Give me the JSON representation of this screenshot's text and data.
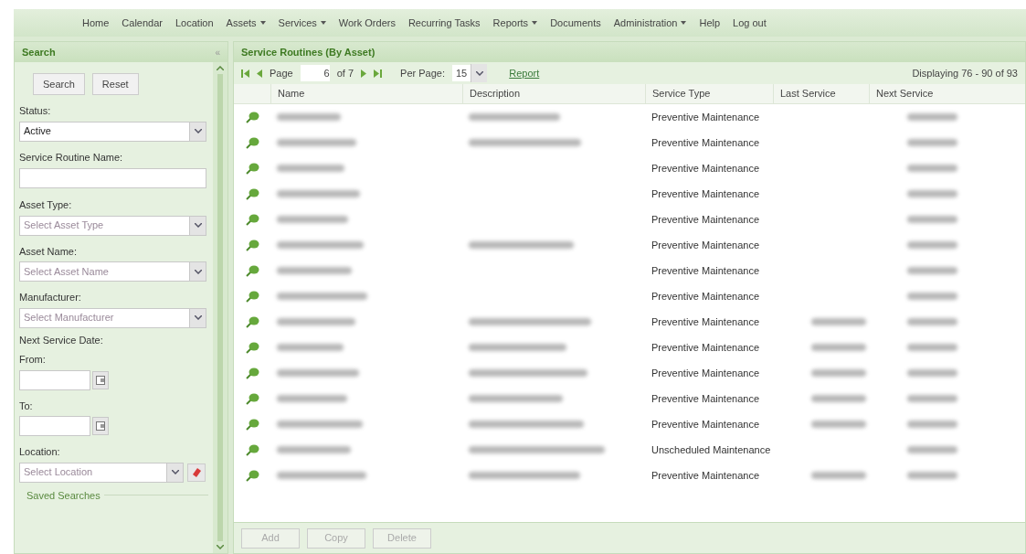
{
  "nav": [
    {
      "label": "Home",
      "dropdown": false
    },
    {
      "label": "Calendar",
      "dropdown": false
    },
    {
      "label": "Location",
      "dropdown": false
    },
    {
      "label": "Assets",
      "dropdown": true
    },
    {
      "label": "Services",
      "dropdown": true
    },
    {
      "label": "Work Orders",
      "dropdown": false
    },
    {
      "label": "Recurring Tasks",
      "dropdown": false
    },
    {
      "label": "Reports",
      "dropdown": true
    },
    {
      "label": "Documents",
      "dropdown": false
    },
    {
      "label": "Administration",
      "dropdown": true
    },
    {
      "label": "Help",
      "dropdown": false
    },
    {
      "label": "Log out",
      "dropdown": false
    }
  ],
  "search_panel": {
    "title": "Search",
    "collapse": "«",
    "buttons": [
      "Search",
      "Reset"
    ],
    "fields": [
      {
        "kind": "select",
        "label": "Status:",
        "value": "Active"
      },
      {
        "kind": "text",
        "label": "Service Routine Name:"
      },
      {
        "kind": "select",
        "label": "Asset Type:",
        "placeholder": "Select Asset Type"
      },
      {
        "kind": "select",
        "label": "Asset Name:",
        "placeholder": "Select Asset Name"
      },
      {
        "kind": "select",
        "label": "Manufacturer:",
        "placeholder": "Select Manufacturer"
      },
      {
        "kind": "heading",
        "label": "Next Service Date:"
      },
      {
        "kind": "date",
        "label": "From:"
      },
      {
        "kind": "date",
        "label": "To:"
      },
      {
        "kind": "select_clear",
        "label": "Location:",
        "placeholder": "Select Location"
      }
    ],
    "saved_searches": "Saved Searches"
  },
  "grid": {
    "title": "Service Routines (By Asset)",
    "page_label": "Page",
    "page": "6",
    "of": "of 7",
    "per_page_label": "Per Page:",
    "per_page": "15",
    "report_link": "Report",
    "display": "Displaying 76 - 90 of 93",
    "columns": [
      "Name",
      "Description",
      "Service Type",
      "Last Service",
      "Next Service"
    ],
    "rows": [
      {
        "service_type": "Preventive Maintenance",
        "description_shown": true,
        "last_service_shown": false
      },
      {
        "service_type": "Preventive Maintenance",
        "description_shown": true,
        "last_service_shown": false
      },
      {
        "service_type": "Preventive Maintenance",
        "description_shown": false,
        "last_service_shown": false
      },
      {
        "service_type": "Preventive Maintenance",
        "description_shown": false,
        "last_service_shown": false
      },
      {
        "service_type": "Preventive Maintenance",
        "description_shown": false,
        "last_service_shown": false
      },
      {
        "service_type": "Preventive Maintenance",
        "description_shown": true,
        "last_service_shown": false
      },
      {
        "service_type": "Preventive Maintenance",
        "description_shown": false,
        "last_service_shown": false
      },
      {
        "service_type": "Preventive Maintenance",
        "description_shown": false,
        "last_service_shown": false
      },
      {
        "service_type": "Preventive Maintenance",
        "description_shown": true,
        "last_service_shown": true
      },
      {
        "service_type": "Preventive Maintenance",
        "description_shown": true,
        "last_service_shown": true
      },
      {
        "service_type": "Preventive Maintenance",
        "description_shown": true,
        "last_service_shown": true
      },
      {
        "service_type": "Preventive Maintenance",
        "description_shown": true,
        "last_service_shown": true
      },
      {
        "service_type": "Preventive Maintenance",
        "description_shown": true,
        "last_service_shown": true
      },
      {
        "service_type": "Unscheduled Maintenance",
        "description_shown": true,
        "last_service_shown": false
      },
      {
        "service_type": "Preventive Maintenance",
        "description_shown": true,
        "last_service_shown": true
      }
    ],
    "actions": [
      {
        "label": "Add",
        "disabled": true
      },
      {
        "label": "Copy",
        "disabled": true
      },
      {
        "label": "Delete",
        "disabled": true
      }
    ]
  }
}
